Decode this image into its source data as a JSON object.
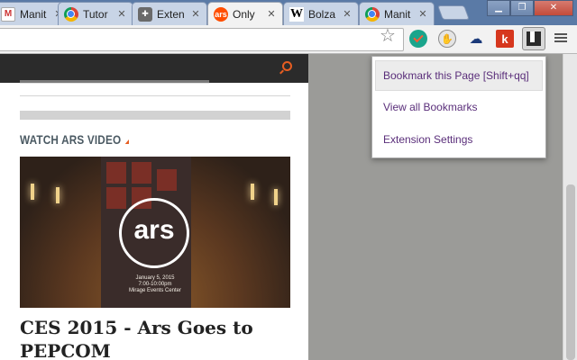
{
  "tabs": [
    {
      "title": "Manit",
      "favicon": "gmail-icon",
      "active": false
    },
    {
      "title": "Tutor",
      "favicon": "chrome-icon",
      "active": false
    },
    {
      "title": "Exten",
      "favicon": "puzzle-icon",
      "active": false
    },
    {
      "title": "Only",
      "favicon": "ars-icon",
      "active": true
    },
    {
      "title": "Bolza",
      "favicon": "wikipedia-icon",
      "active": false
    },
    {
      "title": "Manit",
      "favicon": "chrome-icon",
      "active": false
    }
  ],
  "toolbar": {
    "address_value": "",
    "extensions": [
      "bookmark-star-icon",
      "green-check-icon",
      "hand-icon",
      "cloud-icon",
      "k-icon",
      "bookmark-ext-icon",
      "menu-icon"
    ]
  },
  "page": {
    "section_title": "WATCH ARS VIDEO",
    "video": {
      "logo_text": "ars",
      "caption_line1": "January 5, 2015",
      "caption_line2": "7:00-10:00pm",
      "caption_line3": "Mirage Events Center"
    },
    "headline": "CES 2015 - Ars Goes to PEPCOM"
  },
  "dropdown": {
    "items": [
      {
        "label": "Bookmark this Page [Shift+qq]",
        "highlighted": true
      },
      {
        "label": "View all Bookmarks",
        "highlighted": false
      },
      {
        "label": "Extension Settings",
        "highlighted": false
      }
    ]
  },
  "colors": {
    "accent": "#e65d21",
    "tab_strip": "#5a7aa6",
    "menu_text": "#5a2e7a"
  }
}
